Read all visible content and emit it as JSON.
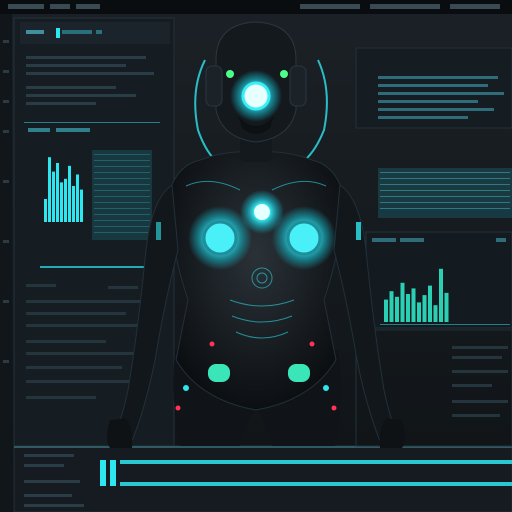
{
  "colors": {
    "background": "#0d1114",
    "panel": "#1a2228",
    "accent": "#2ee6f0",
    "accent_dim": "#1c8f9a",
    "green_glow": "#4dff8a",
    "red_light": "#ff3355",
    "body": "#111418"
  },
  "left_chart_data": {
    "type": "bar",
    "values": [
      0.32,
      0.9,
      0.7,
      0.82,
      0.55,
      0.6,
      0.78,
      0.5,
      0.66,
      0.45
    ]
  },
  "right_chart_data": {
    "type": "bar",
    "values": [
      0.4,
      0.55,
      0.45,
      0.7,
      0.5,
      0.6,
      0.35,
      0.48,
      0.65,
      0.3,
      0.95,
      0.52
    ]
  },
  "icons": [
    "robot-figure",
    "eye-lens-icon",
    "chest-core-icon",
    "chest-light-left-icon",
    "chest-light-right-icon"
  ]
}
